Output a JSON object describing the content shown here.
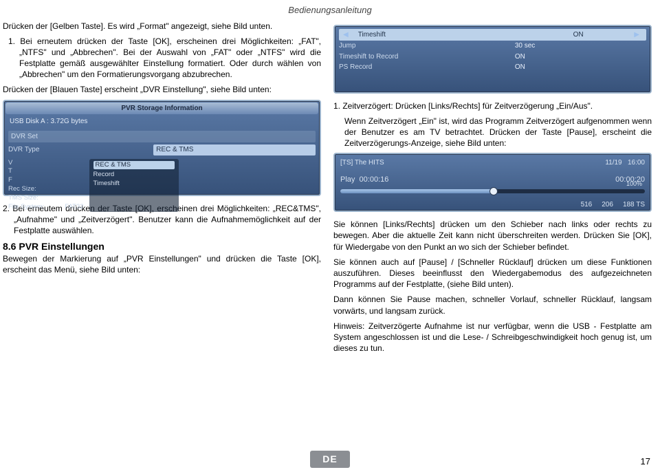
{
  "header": {
    "title": "Bedienungsanleitung"
  },
  "left": {
    "p1": "Drücken der [Gelben Taste]. Es wird „Format\" angezeigt, siehe Bild unten.",
    "li1": "1.  Bei erneutem drücken der Taste [OK], erscheinen drei Möglichkeiten: „FAT\", „NTFS\" und „Abbrechen\". Bei der Auswahl von „FAT\" oder „NTFS\" wird die Festplatte gemäß ausgewählter Einstellung formatiert. Oder durch wählen von „Abbrechen\" um den Formatierungsvorgang abzubrechen.",
    "p2": "Drücken der [Blauen Taste] erscheint „DVR Einstellung\", siehe Bild unten:",
    "ss1": {
      "title": "PVR Storage Information",
      "disk": "USB Disk A : 3.72G bytes",
      "dvrset_label": "DVR Set",
      "dvrtype_label": "DVR Type",
      "dvrtype_value": "REC & TMS",
      "opt1": "REC & TMS",
      "opt2": "Record",
      "opt3": "Timeshift",
      "lines": [
        "V",
        "T",
        "F",
        "Rec Size:",
        "TMS Size:",
        "File System:"
      ],
      "fs": "FAT32"
    },
    "li2": "2. Bei erneutem drücken der Taste [OK], erscheinen drei Möglichkeiten: „REC&TMS\", „Aufnahme\" und „Zeitverzögert\". Benutzer kann die Aufnahmemöglichkeit auf der Festplatte auswählen.",
    "sec_head": "8.6 PVR Einstellungen",
    "sec_body": "Bewegen der Markierung auf „PVR Einstellungen\" und drücken die Taste [OK], erscheint das Menü, siehe Bild unten:"
  },
  "right": {
    "ss2": {
      "r1l": "Timeshift",
      "r1v": "ON",
      "r2l": "Jump",
      "r2v": "30 sec",
      "r3l": "Timeshift to Record",
      "r3v": "ON",
      "r4l": "PS Record",
      "r4v": "ON"
    },
    "li1a": "1. Zeitverzögert: Drücken [Links/Rechts] für Zeitverzögerung „Ein/Aus\".",
    "li1b": "Wenn Zeitverzögert „Ein\" ist, wird das Programm Zeitverzögert aufgenommen wenn der Benutzer es am TV betrachtet. Drücken der Taste [Pause], erscheint die Zeitverzögerungs-Anzeige, siehe Bild unten:",
    "ss3": {
      "topL": "[TS] The HITS",
      "topR1": "11/19",
      "topR2": "16:00",
      "playL": "Play",
      "t1": "00:00:16",
      "t2": "00:00:20",
      "pct": "100%",
      "b1": "516",
      "b2": "206",
      "b3": "188 TS"
    },
    "p2": "Sie können [Links/Rechts] drücken um den Schieber nach links oder rechts zu bewegen. Aber die aktuelle Zeit kann nicht überschreiten werden. Drücken Sie [OK], für Wiedergabe von den Punkt an wo sich der Schieber befindet.",
    "p3": "Sie können auch auf [Pause] / [Schneller Rücklauf] drücken um diese Funktionen auszuführen. Dieses beeinflusst den Wiedergabemodus des aufgezeichneten Programms auf der Festplatte, (siehe Bild unten).",
    "p4": "Dann können Sie Pause machen, schneller Vorlauf, schneller Rücklauf, langsam vorwärts, und langsam zurück.",
    "p5": "Hinweis: Zeitverzögerte Aufnahme ist nur verfügbar, wenn die USB - Festplatte am System angeschlossen ist und die Lese- / Schreibgeschwindigkeit hoch genug ist, um dieses zu tun."
  },
  "footer": {
    "lang": "DE",
    "page": "17"
  }
}
